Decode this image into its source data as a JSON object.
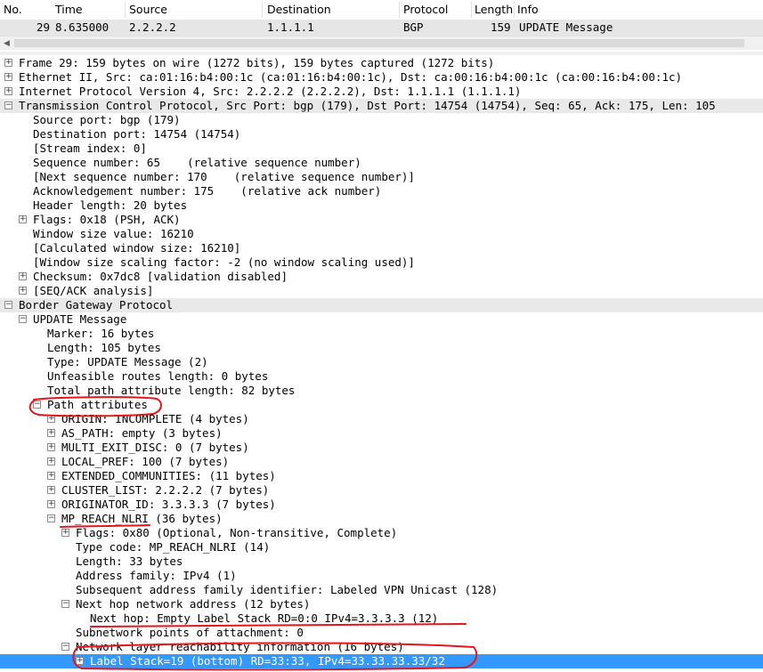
{
  "columns": {
    "no": "No.",
    "time": "Time",
    "source": "Source",
    "destination": "Destination",
    "protocol": "Protocol",
    "length": "Length",
    "info": "Info"
  },
  "packet": {
    "no": "29",
    "time": "8.635000",
    "source": "2.2.2.2",
    "destination": "1.1.1.1",
    "protocol": "BGP",
    "length": "159",
    "info": "UPDATE Message"
  },
  "tree": [
    {
      "text": "Frame 29: 159 bytes on wire (1272 bits), 159 bytes captured (1272 bits)",
      "indent": 0,
      "expander": "+",
      "name": "frame"
    },
    {
      "text": "Ethernet II, Src: ca:01:16:b4:00:1c (ca:01:16:b4:00:1c), Dst: ca:00:16:b4:00:1c (ca:00:16:b4:00:1c)",
      "indent": 0,
      "expander": "+",
      "name": "ethernet"
    },
    {
      "text": "Internet Protocol Version 4, Src: 2.2.2.2 (2.2.2.2), Dst: 1.1.1.1 (1.1.1.1)",
      "indent": 0,
      "expander": "+",
      "name": "ipv4"
    },
    {
      "text": "Transmission Control Protocol, Src Port: bgp (179), Dst Port: 14754 (14754), Seq: 65, Ack: 175, Len: 105",
      "indent": 0,
      "expander": "-",
      "name": "tcp",
      "grey": true
    },
    {
      "text": "Source port: bgp (179)",
      "indent": 1,
      "expander": "",
      "name": "tcp-source-port"
    },
    {
      "text": "Destination port: 14754 (14754)",
      "indent": 1,
      "expander": "",
      "name": "tcp-destination-port"
    },
    {
      "text": "[Stream index: 0]",
      "indent": 1,
      "expander": "",
      "name": "tcp-stream-index"
    },
    {
      "text": "Sequence number: 65    (relative sequence number)",
      "indent": 1,
      "expander": "",
      "name": "tcp-seq"
    },
    {
      "text": "[Next sequence number: 170    (relative sequence number)]",
      "indent": 1,
      "expander": "",
      "name": "tcp-next-seq"
    },
    {
      "text": "Acknowledgement number: 175    (relative ack number)",
      "indent": 1,
      "expander": "",
      "name": "tcp-ack"
    },
    {
      "text": "Header length: 20 bytes",
      "indent": 1,
      "expander": "",
      "name": "tcp-header-length"
    },
    {
      "text": "Flags: 0x18 (PSH, ACK)",
      "indent": 1,
      "expander": "+",
      "name": "tcp-flags"
    },
    {
      "text": "Window size value: 16210",
      "indent": 1,
      "expander": "",
      "name": "tcp-window-size"
    },
    {
      "text": "[Calculated window size: 16210]",
      "indent": 1,
      "expander": "",
      "name": "tcp-calc-window"
    },
    {
      "text": "[Window size scaling factor: -2 (no window scaling used)]",
      "indent": 1,
      "expander": "",
      "name": "tcp-window-scaling"
    },
    {
      "text": "Checksum: 0x7dc8 [validation disabled]",
      "indent": 1,
      "expander": "+",
      "name": "tcp-checksum"
    },
    {
      "text": "[SEQ/ACK analysis]",
      "indent": 1,
      "expander": "+",
      "name": "tcp-seq-ack-analysis"
    },
    {
      "text": "Border Gateway Protocol",
      "indent": 0,
      "expander": "-",
      "name": "bgp",
      "grey": true
    },
    {
      "text": "UPDATE Message",
      "indent": 1,
      "expander": "-",
      "name": "bgp-update"
    },
    {
      "text": "Marker: 16 bytes",
      "indent": 2,
      "expander": "",
      "name": "bgp-marker"
    },
    {
      "text": "Length: 105 bytes",
      "indent": 2,
      "expander": "",
      "name": "bgp-length"
    },
    {
      "text": "Type: UPDATE Message (2)",
      "indent": 2,
      "expander": "",
      "name": "bgp-type"
    },
    {
      "text": "Unfeasible routes length: 0 bytes",
      "indent": 2,
      "expander": "",
      "name": "bgp-unfeasible-length"
    },
    {
      "text": "Total path attribute length: 82 bytes",
      "indent": 2,
      "expander": "",
      "name": "bgp-total-path-attr-length"
    },
    {
      "text": "Path attributes",
      "indent": 2,
      "expander": "-",
      "name": "bgp-path-attributes"
    },
    {
      "text": "ORIGIN: INCOMPLETE (4 bytes)",
      "indent": 3,
      "expander": "+",
      "name": "attr-origin"
    },
    {
      "text": "AS_PATH: empty (3 bytes)",
      "indent": 3,
      "expander": "+",
      "name": "attr-as-path"
    },
    {
      "text": "MULTI_EXIT_DISC: 0 (7 bytes)",
      "indent": 3,
      "expander": "+",
      "name": "attr-med"
    },
    {
      "text": "LOCAL_PREF: 100 (7 bytes)",
      "indent": 3,
      "expander": "+",
      "name": "attr-local-pref"
    },
    {
      "text": "EXTENDED_COMMUNITIES: (11 bytes)",
      "indent": 3,
      "expander": "+",
      "name": "attr-ext-communities"
    },
    {
      "text": "CLUSTER_LIST: 2.2.2.2 (7 bytes)",
      "indent": 3,
      "expander": "+",
      "name": "attr-cluster-list"
    },
    {
      "text": "ORIGINATOR_ID: 3.3.3.3 (7 bytes)",
      "indent": 3,
      "expander": "+",
      "name": "attr-originator-id"
    },
    {
      "text": "MP_REACH_NLRI (36 bytes)",
      "indent": 3,
      "expander": "-",
      "name": "attr-mp-reach-nlri"
    },
    {
      "text": "Flags: 0x80 (Optional, Non-transitive, Complete)",
      "indent": 4,
      "expander": "+",
      "name": "mp-flags"
    },
    {
      "text": "Type code: MP_REACH_NLRI (14)",
      "indent": 4,
      "expander": "",
      "name": "mp-type-code"
    },
    {
      "text": "Length: 33 bytes",
      "indent": 4,
      "expander": "",
      "name": "mp-length"
    },
    {
      "text": "Address family: IPv4 (1)",
      "indent": 4,
      "expander": "",
      "name": "mp-address-family"
    },
    {
      "text": "Subsequent address family identifier: Labeled VPN Unicast (128)",
      "indent": 4,
      "expander": "",
      "name": "mp-safi"
    },
    {
      "text": "Next hop network address (12 bytes)",
      "indent": 4,
      "expander": "-",
      "name": "mp-next-hop-address"
    },
    {
      "text": "Next hop: Empty Label Stack RD=0:0 IPv4=3.3.3.3 (12)",
      "indent": 5,
      "expander": "",
      "name": "mp-next-hop"
    },
    {
      "text": "Subnetwork points of attachment: 0",
      "indent": 4,
      "expander": "",
      "name": "mp-snpa"
    },
    {
      "text": "Network layer reachability information (16 bytes)",
      "indent": 4,
      "expander": "-",
      "name": "mp-nlri"
    },
    {
      "text": "Label Stack=19 (bottom) RD=33:33, IPv4=33.33.33.33/32",
      "indent": 5,
      "expander": "+",
      "name": "mp-nlri-label-stack",
      "selected": true
    }
  ]
}
